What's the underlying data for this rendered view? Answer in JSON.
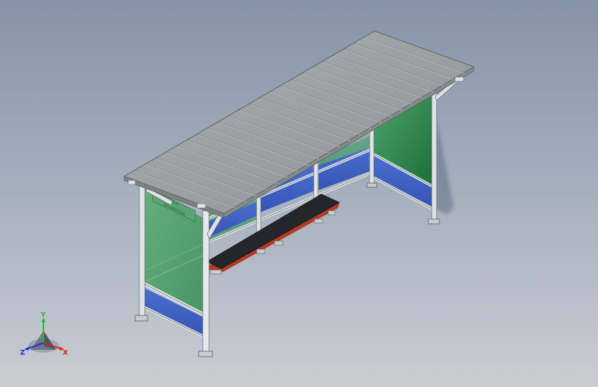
{
  "viewport": {
    "background_top": "#8593a8",
    "background_bottom": "#c9cdd3"
  },
  "model": {
    "object": "bus-shelter",
    "sign_text_line1": "PUBLIC",
    "sign_text_line2": "INFORMATION",
    "colors": {
      "roof": "#9da2a2",
      "roof_edge": "#6f7474",
      "frame": "#dfe3e6",
      "frame_edge": "#6d7277",
      "glass_green": "#3f9a5c",
      "glass_blue": "#4163c4",
      "bench_top": "#23262b",
      "bench_edge": "#b23a26"
    }
  },
  "triad": {
    "x_label": "X",
    "y_label": "Y",
    "z_label": "Z",
    "x_color": "#e02020",
    "y_color": "#2fb53a",
    "z_color": "#2030d8"
  }
}
